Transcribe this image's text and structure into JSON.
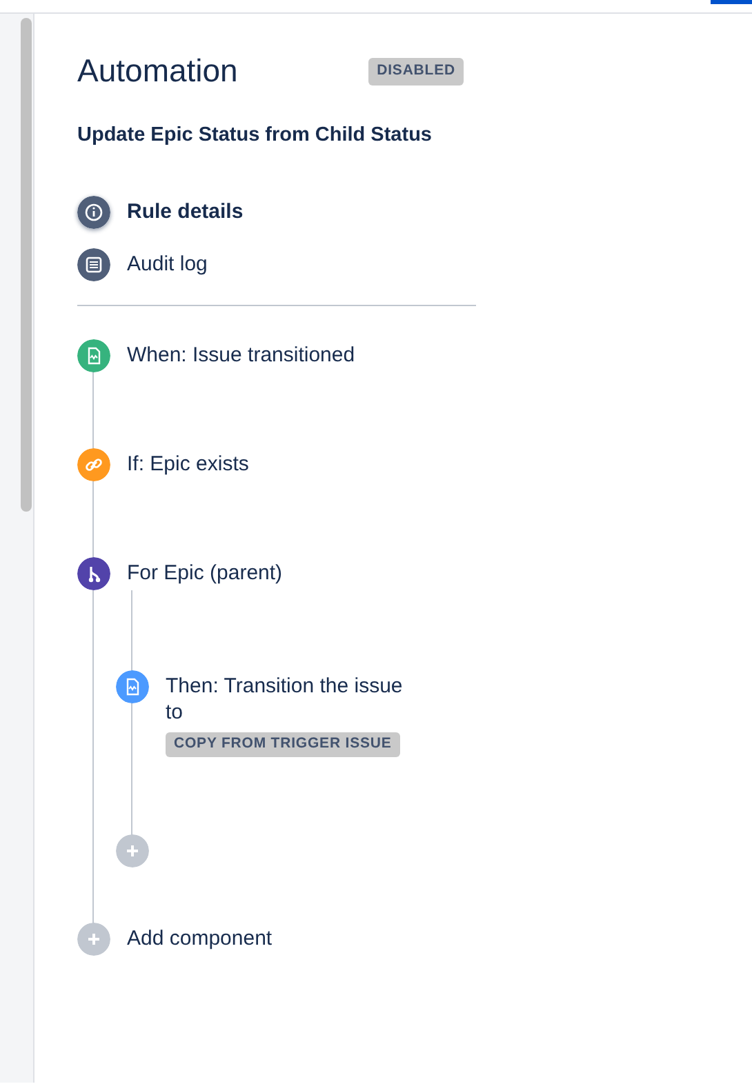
{
  "header": {
    "title": "Automation",
    "status": "DISABLED"
  },
  "rule_name": "Update Epic Status from Child Status",
  "nav": [
    {
      "kind": "info",
      "label": "Rule details",
      "selected": true
    },
    {
      "kind": "list",
      "label": "Audit log",
      "selected": false
    }
  ],
  "steps": [
    {
      "kind": "trigger",
      "label": "When: Issue transitioned"
    },
    {
      "kind": "condition",
      "label": "If: Epic exists"
    },
    {
      "kind": "branch",
      "label": "For Epic (parent)",
      "children": [
        {
          "kind": "action",
          "label": "Then: Transition the issue to",
          "tag": "COPY FROM TRIGGER ISSUE"
        },
        {
          "kind": "add"
        }
      ]
    },
    {
      "kind": "add",
      "label": "Add component"
    }
  ]
}
